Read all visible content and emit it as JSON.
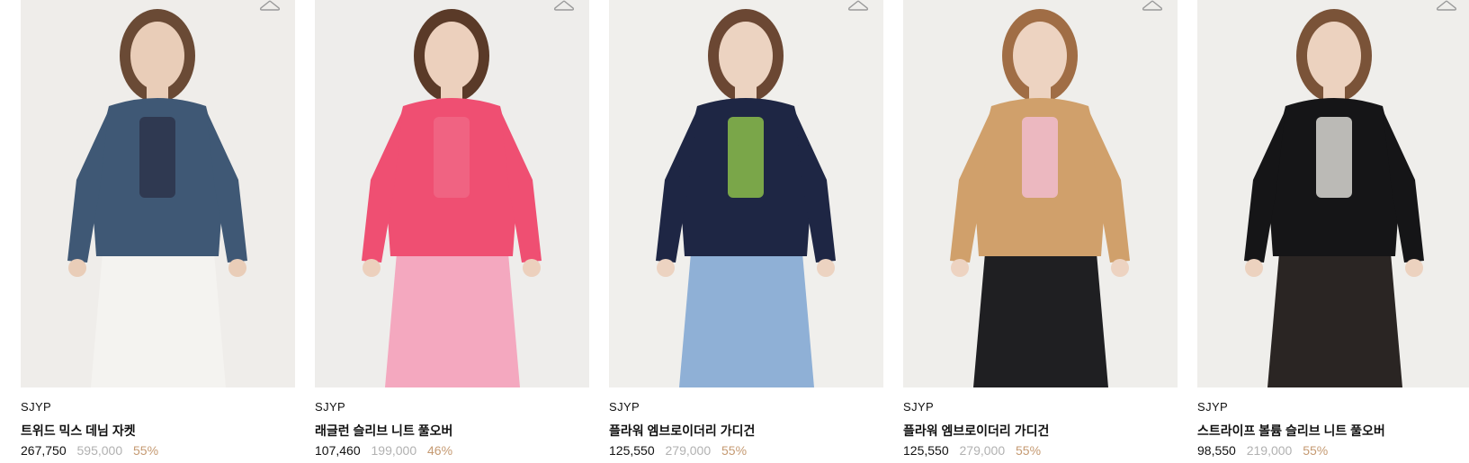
{
  "products": [
    {
      "brand": "SJYP",
      "name": "트위드 믹스 데님 자켓",
      "price": "267,750",
      "original_price": "595,000",
      "discount": "55%",
      "image_subject": "tweed-denim-jacket",
      "colors": {
        "bg": "#efedea",
        "top": "#3f5875",
        "bottom": "#f4f3f0",
        "accent": "#2b2f45",
        "skin": "#e9cdb8",
        "hair": "#6a4a35"
      }
    },
    {
      "brand": "SJYP",
      "name": "래글런 슬리브 니트 풀오버",
      "price": "107,460",
      "original_price": "199,000",
      "discount": "46%",
      "image_subject": "pink-mesh-knit-pullover",
      "colors": {
        "bg": "#eeedeb",
        "top": "#ef4f72",
        "bottom": "#f4a8bf",
        "accent": "#f06a88",
        "skin": "#ecd0bd",
        "hair": "#5a3a28"
      }
    },
    {
      "brand": "SJYP",
      "name": "플라워 엠브로이더리 가디건",
      "price": "125,550",
      "original_price": "279,000",
      "discount": "55%",
      "image_subject": "navy-flower-cardigan",
      "colors": {
        "bg": "#f0efec",
        "top": "#1e2644",
        "bottom": "#8fb0d6",
        "accent": "#9ad24b",
        "skin": "#ecd3c1",
        "hair": "#6b4733"
      }
    },
    {
      "brand": "SJYP",
      "name": "플라워 엠브로이더리 가디건",
      "price": "125,550",
      "original_price": "279,000",
      "discount": "55%",
      "image_subject": "camel-flower-cardigan",
      "colors": {
        "bg": "#efeeeb",
        "top": "#d0a06b",
        "bottom": "#1f1f22",
        "accent": "#f5c0dc",
        "skin": "#edd3c1",
        "hair": "#a06d45"
      }
    },
    {
      "brand": "SJYP",
      "name": "스트라이프 볼륨 슬리브 니트 풀오버",
      "price": "98,550",
      "original_price": "219,000",
      "discount": "55%",
      "image_subject": "black-striped-knit-pullover",
      "colors": {
        "bg": "#efeeeb",
        "top": "#151517",
        "bottom": "#2a2523",
        "accent": "#f3f1ec",
        "skin": "#ecd2bf",
        "hair": "#7a5338"
      }
    }
  ],
  "wishlist_icon": "hanger-icon"
}
